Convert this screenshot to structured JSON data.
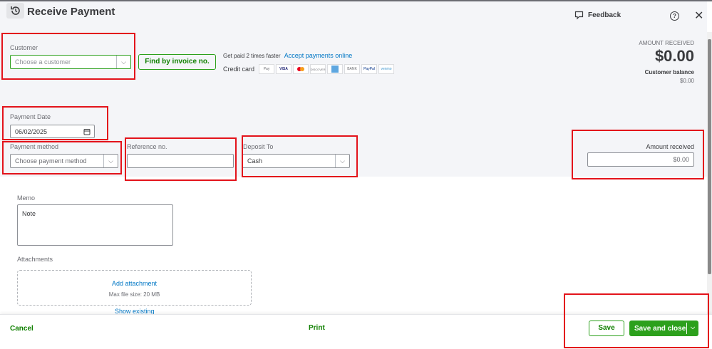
{
  "header": {
    "title": "Receive Payment",
    "feedback": "Feedback"
  },
  "customer": {
    "label": "Customer",
    "placeholder": "Choose a customer",
    "find_button": "Find by invoice no."
  },
  "promo": {
    "text": "Get paid 2 times faster",
    "link": "Accept payments online",
    "credit_card_label": "Credit card",
    "cards": [
      "Pay",
      "VISA",
      "MC",
      "DISCOVER",
      "AMEX",
      "BANK",
      "PayPal",
      "venmo"
    ]
  },
  "summary": {
    "amount_label": "AMOUNT RECEIVED",
    "amount": "$0.00",
    "balance_label": "Customer balance",
    "balance": "$0.00"
  },
  "payment_date": {
    "label": "Payment Date",
    "value": "06/02/2025"
  },
  "payment_method": {
    "label": "Payment method",
    "placeholder": "Choose payment method"
  },
  "reference": {
    "label": "Reference no.",
    "value": ""
  },
  "deposit": {
    "label": "Deposit To",
    "value": "Cash"
  },
  "amount_received": {
    "label": "Amount received",
    "value": "$0.00"
  },
  "memo": {
    "label": "Memo",
    "value": "Note"
  },
  "attachments": {
    "label": "Attachments",
    "add": "Add attachment",
    "max": "Max file size: 20 MB",
    "show": "Show existing"
  },
  "footer": {
    "cancel": "Cancel",
    "print": "Print",
    "save": "Save",
    "save_close": "Save and close"
  }
}
